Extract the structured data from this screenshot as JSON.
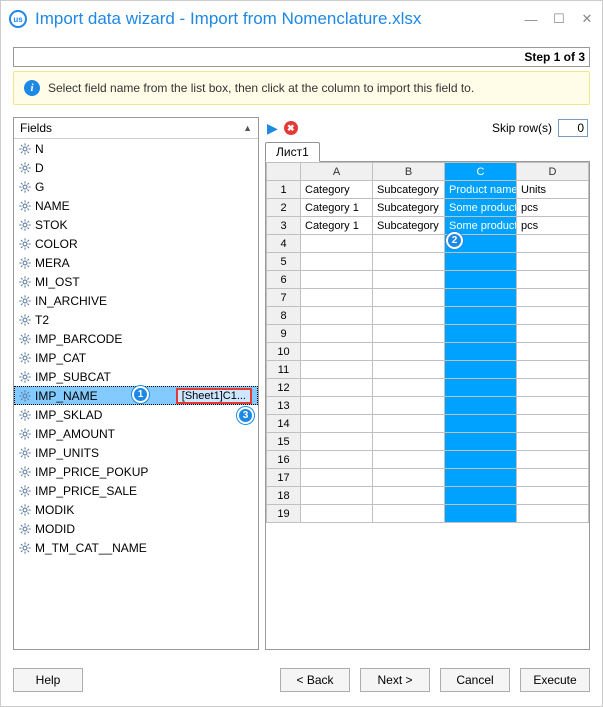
{
  "window": {
    "title": "Import data wizard - Import from Nomenclature.xlsx"
  },
  "step": {
    "text": "Step 1 of 3"
  },
  "hint": {
    "text": "Select field name from the list box, then click at the column to import this field to."
  },
  "fields": {
    "header": "Fields",
    "items": [
      {
        "name": "N"
      },
      {
        "name": "D"
      },
      {
        "name": "G"
      },
      {
        "name": "NAME"
      },
      {
        "name": "STOK"
      },
      {
        "name": "COLOR"
      },
      {
        "name": "MERA"
      },
      {
        "name": "MI_OST"
      },
      {
        "name": "IN_ARCHIVE"
      },
      {
        "name": "T2"
      },
      {
        "name": "IMP_BARCODE"
      },
      {
        "name": "IMP_CAT"
      },
      {
        "name": "IMP_SUBCAT"
      },
      {
        "name": "IMP_NAME",
        "selected": true,
        "mapping": "[Sheet1]C1..."
      },
      {
        "name": "IMP_SKLAD"
      },
      {
        "name": "IMP_AMOUNT"
      },
      {
        "name": "IMP_UNITS"
      },
      {
        "name": "IMP_PRICE_POKUP"
      },
      {
        "name": "IMP_PRICE_SALE"
      },
      {
        "name": "MODIK"
      },
      {
        "name": "MODID"
      },
      {
        "name": "M_TM_CAT__NAME"
      }
    ]
  },
  "toolbar": {
    "skip_label": "Skip row(s)",
    "skip_value": "0"
  },
  "sheets": {
    "active": "Лист1"
  },
  "grid": {
    "columns": [
      "A",
      "B",
      "C",
      "D"
    ],
    "selected_col_index": 2,
    "rows": [
      {
        "n": 1,
        "cells": [
          "Category",
          "Subcategory",
          "Product name",
          "Units"
        ]
      },
      {
        "n": 2,
        "cells": [
          "Category 1",
          "Subcategory",
          "Some product",
          "pcs"
        ]
      },
      {
        "n": 3,
        "cells": [
          "Category 1",
          "Subcategory",
          "Some product",
          "pcs"
        ]
      },
      {
        "n": 4,
        "cells": [
          "",
          "",
          "",
          ""
        ]
      },
      {
        "n": 5,
        "cells": [
          "",
          "",
          "",
          ""
        ]
      },
      {
        "n": 6,
        "cells": [
          "",
          "",
          "",
          ""
        ]
      },
      {
        "n": 7,
        "cells": [
          "",
          "",
          "",
          ""
        ]
      },
      {
        "n": 8,
        "cells": [
          "",
          "",
          "",
          ""
        ]
      },
      {
        "n": 9,
        "cells": [
          "",
          "",
          "",
          ""
        ]
      },
      {
        "n": 10,
        "cells": [
          "",
          "",
          "",
          ""
        ]
      },
      {
        "n": 11,
        "cells": [
          "",
          "",
          "",
          ""
        ]
      },
      {
        "n": 12,
        "cells": [
          "",
          "",
          "",
          ""
        ]
      },
      {
        "n": 13,
        "cells": [
          "",
          "",
          "",
          ""
        ]
      },
      {
        "n": 14,
        "cells": [
          "",
          "",
          "",
          ""
        ]
      },
      {
        "n": 15,
        "cells": [
          "",
          "",
          "",
          ""
        ]
      },
      {
        "n": 16,
        "cells": [
          "",
          "",
          "",
          ""
        ]
      },
      {
        "n": 17,
        "cells": [
          "",
          "",
          "",
          ""
        ]
      },
      {
        "n": 18,
        "cells": [
          "",
          "",
          "",
          ""
        ]
      },
      {
        "n": 19,
        "cells": [
          "",
          "",
          "",
          ""
        ]
      }
    ]
  },
  "callouts": {
    "c1": "1",
    "c2": "2",
    "c3": "3"
  },
  "buttons": {
    "help": "Help",
    "back": "< Back",
    "next": "Next >",
    "cancel": "Cancel",
    "execute": "Execute"
  }
}
